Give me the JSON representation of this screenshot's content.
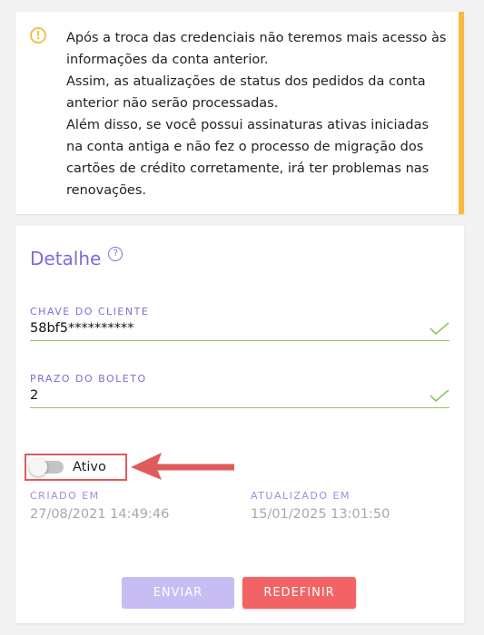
{
  "warning": {
    "icon": "alert-circle-icon",
    "accent_color": "#f7b941",
    "lines": [
      "Após a troca das credenciais não teremos mais acesso às informações da conta anterior.",
      "Assim, as atualizações de status dos pedidos da conta anterior não serão processadas.",
      "Além disso, se você possui assinaturas ativas iniciadas na conta antiga e não fez o processo de migração dos cartões de crédito corretamente, irá ter problemas nas renovações."
    ]
  },
  "detail": {
    "title": "Detalhe",
    "help_icon": "help-circle-icon",
    "fields": [
      {
        "label": "CHAVE DO CLIENTE",
        "value": "58bf5**********"
      },
      {
        "label": "PRAZO DO BOLETO",
        "value": "2"
      }
    ],
    "toggle": {
      "label": "Ativo",
      "checked": false
    },
    "created": {
      "label": "CRIADO EM",
      "value": "27/08/2021 14:49:46"
    },
    "updated": {
      "label": "ATUALIZADO EM",
      "value": "15/01/2025 13:01:50"
    },
    "buttons": {
      "submit": "ENVIAR",
      "reset": "REDEFINIR"
    }
  },
  "colors": {
    "accent": "#7d6cd7",
    "valid": "#94c45a",
    "danger": "#f36366",
    "disabled": "#c8bdf3",
    "annotation": "#e05a5a"
  }
}
